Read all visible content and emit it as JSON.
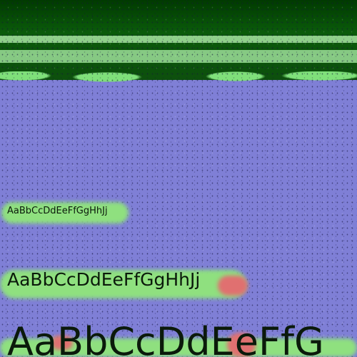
{
  "samples": {
    "small": "AaBbCcDdEeFfGgHhJj",
    "medium": "AaBbCcDdEeFfGgHhJj",
    "large": "AaBbCcDdEeFfG"
  },
  "colors": {
    "background": "#7f7fd6",
    "header": "#0a5a0a",
    "highlight_green": "#8fe07f",
    "highlight_red": "#e07070",
    "text": "#0b1a0b"
  }
}
